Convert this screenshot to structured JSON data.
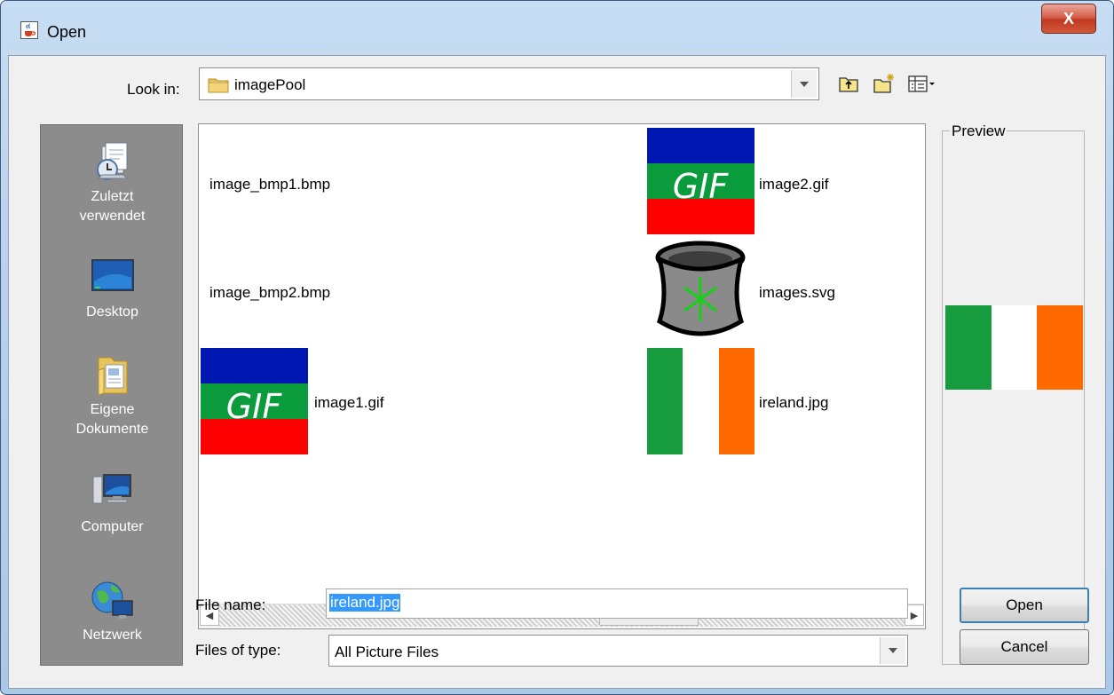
{
  "window": {
    "title": "Open",
    "close_glyph": "X",
    "title_icon": "java-cup-icon"
  },
  "lookin": {
    "label": "Look in:",
    "value": "imagePool",
    "folder_icon": "folder-icon"
  },
  "toolbar": [
    {
      "name": "up-one-level-button",
      "icon": "folder-up-icon"
    },
    {
      "name": "create-new-folder-button",
      "icon": "new-folder-icon"
    },
    {
      "name": "view-menu-button",
      "icon": "details-view-icon"
    }
  ],
  "places": [
    {
      "label": "Zuletzt verwendet",
      "icon": "recent-items-icon"
    },
    {
      "label": "Desktop",
      "icon": "desktop-icon"
    },
    {
      "label": "Eigene Dokumente",
      "icon": "documents-icon"
    },
    {
      "label": "Computer",
      "icon": "computer-icon"
    },
    {
      "label": "Netzwerk",
      "icon": "network-icon"
    }
  ],
  "files": [
    {
      "name": "image_bmp1.bmp",
      "thumb": "none"
    },
    {
      "name": "image_bmp2.bmp",
      "thumb": "none"
    },
    {
      "name": "image1.gif",
      "thumb": "gif",
      "thumb_text": "GIF"
    },
    {
      "name": "image2.gif",
      "thumb": "gif",
      "thumb_text": "GIF"
    },
    {
      "name": "images.svg",
      "thumb": "svg-pot"
    },
    {
      "name": "ireland.jpg",
      "thumb": "irish-flag"
    }
  ],
  "preview": {
    "label": "Preview",
    "image": "irish-flag"
  },
  "filename": {
    "label": "File name:",
    "value": "ireland.jpg"
  },
  "filetype": {
    "label": "Files of type:",
    "value": "All Picture Files"
  },
  "buttons": {
    "open": "Open",
    "cancel": "Cancel"
  },
  "colors": {
    "flag_green": "#169b3e",
    "flag_white": "#ffffff",
    "flag_orange": "#ff6a00",
    "gif_blue": "#0017b2",
    "gif_green": "#0a9c3c",
    "gif_red": "#ff0000",
    "selection": "#3399ff",
    "places_bg": "#8c8c8c"
  }
}
